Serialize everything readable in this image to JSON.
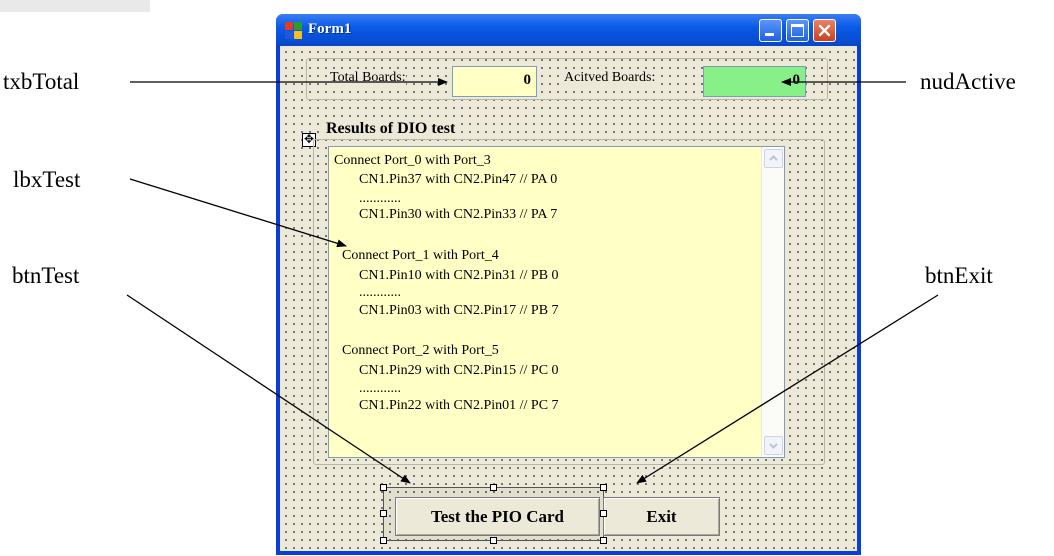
{
  "window": {
    "title": "Form1"
  },
  "form": {
    "total_label": "Total Boards:",
    "total_value": "0",
    "active_label": "Acitved Boards:",
    "active_value": "0",
    "group_title": "Results of DIO test",
    "listbox_lines": [
      "Connect Port_0 with Port_3",
      "CN1.Pin37 with CN2.Pin47   // PA 0",
      "............",
      "CN1.Pin30 with CN2.Pin33   // PA 7",
      "Connect Port_1 with Port_4",
      "CN1.Pin10 with CN2.Pin31   // PB 0",
      "............",
      "CN1.Pin03 with CN2.Pin17   // PB 7",
      "Connect Port_2 with Port_5",
      "CN1.Pin29 with CN2.Pin15   // PC 0",
      "............",
      "CN1.Pin22 with CN2.Pin01   // PC 7"
    ],
    "test_button": "Test the PIO Card",
    "exit_button": "Exit"
  },
  "callouts": {
    "txbTotal": "txbTotal",
    "nudActive": "nudActive",
    "lbxTest": "lbxTest",
    "btnTest": "btnTest",
    "btnExit": "btnExit"
  },
  "colors": {
    "titlebar": "#0a5be8",
    "form_bg": "#ece9d8",
    "total_box": "#ffffc6",
    "active_box": "#88f088",
    "listbox_bg": "#ffffc6"
  },
  "icons": [
    "form-app-icon",
    "minimize-icon",
    "maximize-icon",
    "close-icon",
    "move-handle-icon",
    "scroll-up-icon",
    "scroll-down-icon"
  ]
}
